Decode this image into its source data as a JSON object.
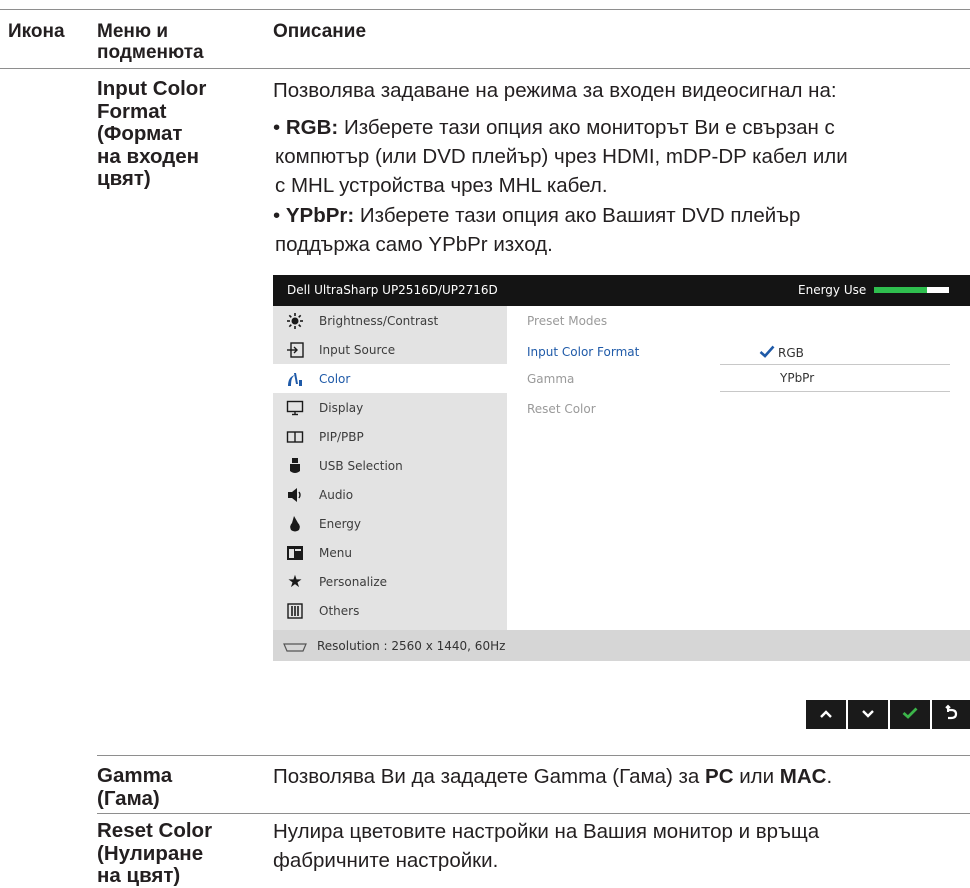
{
  "table": {
    "header": {
      "icon": "Икона",
      "menu_line1": "Меню и",
      "menu_line2": "подменюта",
      "description": "Описание"
    },
    "rows": [
      {
        "name_lines": [
          "Input Color",
          "Format",
          "(Формат",
          "на входен",
          "цвят)"
        ],
        "intro": "Позволява задаване на режима за входен видеосигнал на:",
        "bullets": [
          {
            "label": "RGB:",
            "lines": [
              " Изберете тази опция ако мониторът Ви е свързан с",
              "компютър (или DVD плейър) чрез HDMI, mDP-DP кабел или",
              "с MHL устройства чрез MHL кабел."
            ]
          },
          {
            "label": "YPbPr:",
            "lines": [
              " Изберете тази опция ако Вашият DVD плейър",
              "поддържа само YPbPr изход."
            ]
          }
        ]
      },
      {
        "name_lines": [
          "Gamma",
          "(Гама)"
        ],
        "desc_pre": "Позволява Ви да зададете Gamma (Гама) за ",
        "desc_b1": "PC",
        "desc_mid": " или ",
        "desc_b2": "MAC",
        "desc_post": "."
      },
      {
        "name_lines": [
          "Reset Color",
          "(Нулиране",
          "на цвят)"
        ],
        "desc_lines": [
          "Нулира цветовите настройки на Вашия монитор и връща",
          "фабричните настройки."
        ]
      }
    ]
  },
  "osd": {
    "title": "Dell UltraSharp UP2516D/UP2716D",
    "energy_label": "Energy Use",
    "energy_level": 0.7,
    "menu_items": [
      {
        "label": "Brightness/Contrast",
        "icon": "brightness-icon",
        "selected": false
      },
      {
        "label": "Input Source",
        "icon": "input-source-icon",
        "selected": false
      },
      {
        "label": "Color",
        "icon": "color-icon",
        "selected": true
      },
      {
        "label": "Display",
        "icon": "display-icon",
        "selected": false
      },
      {
        "label": "PIP/PBP",
        "icon": "pip-icon",
        "selected": false
      },
      {
        "label": "USB Selection",
        "icon": "usb-icon",
        "selected": false
      },
      {
        "label": "Audio",
        "icon": "audio-icon",
        "selected": false
      },
      {
        "label": "Energy",
        "icon": "energy-icon",
        "selected": false
      },
      {
        "label": "Menu",
        "icon": "menu-icon",
        "selected": false
      },
      {
        "label": "Personalize",
        "icon": "star-icon",
        "selected": false
      },
      {
        "label": "Others",
        "icon": "others-icon",
        "selected": false
      }
    ],
    "content_items": [
      {
        "label": "Preset Modes",
        "selected": false
      },
      {
        "label": "Input Color Format",
        "selected": true
      },
      {
        "label": "Gamma",
        "selected": false
      },
      {
        "label": "Reset Color",
        "selected": false
      }
    ],
    "options": [
      {
        "label": "RGB",
        "checked": true
      },
      {
        "label": "YPbPr",
        "checked": false
      }
    ],
    "status": "Resolution : 2560 x 1440, 60Hz"
  },
  "nav_buttons": [
    "up-arrow-icon",
    "down-arrow-icon",
    "check-icon",
    "back-icon"
  ],
  "colors": {
    "osd_titlebar": "#141414",
    "osd_menu_bg": "#e3e3e3",
    "osd_accent": "#1f5aa8",
    "energy_bar": "#2fbf4f",
    "check_green": "#3cb54a",
    "nav_btn_bg": "#1a1a1a"
  }
}
